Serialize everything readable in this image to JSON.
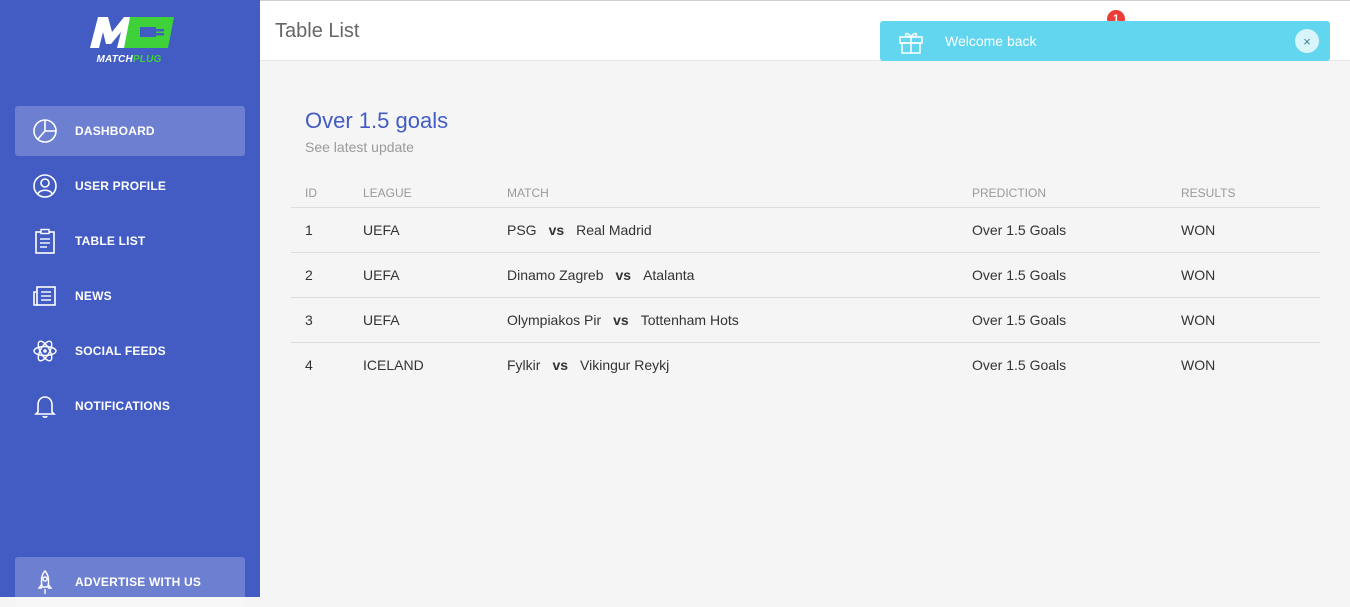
{
  "brand": {
    "logo_text_a": "MATCH",
    "logo_text_b": "PLUG",
    "accent": "#3fd13a",
    "primary": "#435cc4"
  },
  "sidebar": {
    "items": [
      {
        "label": "DASHBOARD",
        "icon": "pie-chart-icon",
        "active": true
      },
      {
        "label": "USER PROFILE",
        "icon": "user-icon",
        "active": false
      },
      {
        "label": "TABLE LIST",
        "icon": "clipboard-icon",
        "active": false
      },
      {
        "label": "NEWS",
        "icon": "newspaper-icon",
        "active": false
      },
      {
        "label": "SOCIAL FEEDS",
        "icon": "atom-icon",
        "active": false
      },
      {
        "label": "NOTIFICATIONS",
        "icon": "bell-icon",
        "active": false
      }
    ],
    "advertise_label": "ADVERTISE WITH US",
    "advertise_icon": "rocket-icon"
  },
  "header": {
    "title": "Table List",
    "notification_count": "1"
  },
  "toast": {
    "message": "Welcome back",
    "icon": "gift-icon",
    "close": "×",
    "color": "#61d6ee"
  },
  "card": {
    "title": "Over 1.5 goals",
    "subtitle": "See latest update",
    "columns": [
      "ID",
      "LEAGUE",
      "MATCH",
      "PREDICTION",
      "RESULTS"
    ],
    "rows": [
      {
        "id": "1",
        "league": "UEFA",
        "home": "PSG",
        "vs": "vs",
        "away": "Real Madrid",
        "prediction": "Over 1.5 Goals",
        "result": "WON"
      },
      {
        "id": "2",
        "league": "UEFA",
        "home": "Dinamo Zagreb",
        "vs": "vs",
        "away": "Atalanta",
        "prediction": "Over 1.5 Goals",
        "result": "WON"
      },
      {
        "id": "3",
        "league": "UEFA",
        "home": "Olympiakos Pir",
        "vs": "vs",
        "away": "Tottenham Hots",
        "prediction": "Over 1.5 Goals",
        "result": "WON"
      },
      {
        "id": "4",
        "league": "ICELAND",
        "home": "Fylkir",
        "vs": "vs",
        "away": "Vikingur Reykj",
        "prediction": "Over 1.5 Goals",
        "result": "WON"
      }
    ]
  }
}
